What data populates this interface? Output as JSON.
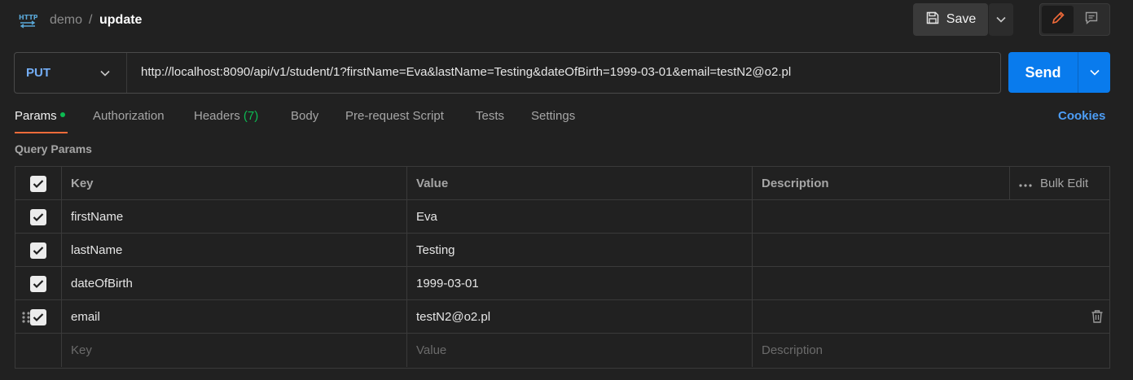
{
  "header": {
    "collection": "demo",
    "separator": "/",
    "request_name": "update",
    "save_label": "Save"
  },
  "request": {
    "method": "PUT",
    "url": "http://localhost:8090/api/v1/student/1?firstName=Eva&lastName=Testing&dateOfBirth=1999-03-01&email=testN2@o2.pl",
    "send_label": "Send"
  },
  "tabs": [
    {
      "label": "Params",
      "active": true
    },
    {
      "label": "Authorization"
    },
    {
      "label": "Headers",
      "count": "(7)"
    },
    {
      "label": "Body"
    },
    {
      "label": "Pre-request Script"
    },
    {
      "label": "Tests"
    },
    {
      "label": "Settings"
    }
  ],
  "cookies_label": "Cookies",
  "query_params": {
    "title": "Query Params",
    "columns": {
      "key": "Key",
      "value": "Value",
      "description": "Description",
      "bulk_edit": "Bulk Edit"
    },
    "rows": [
      {
        "key": "firstName",
        "value": "Eva",
        "checked": true
      },
      {
        "key": "lastName",
        "value": "Testing",
        "checked": true
      },
      {
        "key": "dateOfBirth",
        "value": "1999-03-01",
        "checked": true
      },
      {
        "key": "email",
        "value": "testN2@o2.pl",
        "checked": true
      }
    ],
    "placeholders": {
      "key": "Key",
      "value": "Value",
      "description": "Description"
    }
  },
  "colors": {
    "accent_send": "#097bed",
    "method_put": "#74aef6",
    "tab_underline": "#f26b3a",
    "status_green": "#0cbb52",
    "cookies_link": "#4d9ef6"
  }
}
